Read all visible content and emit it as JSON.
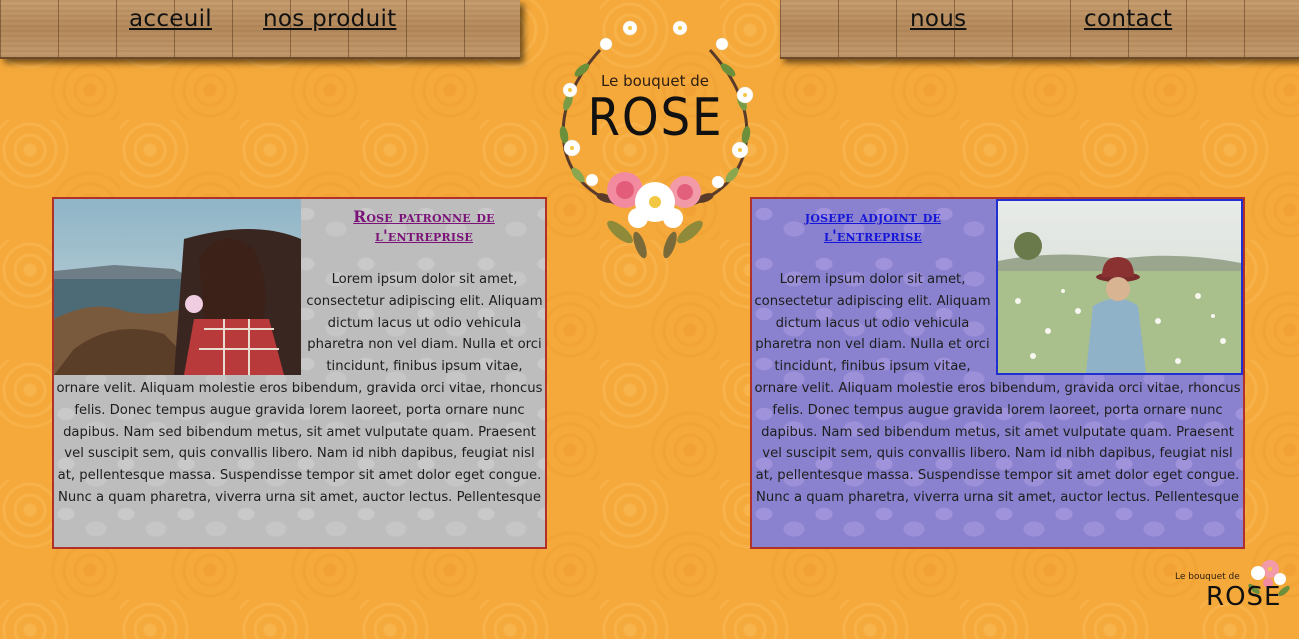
{
  "nav": {
    "left": [
      {
        "label": "acceuil"
      },
      {
        "label": "nos produit"
      }
    ],
    "right": [
      {
        "label": "nous"
      },
      {
        "label": "contact"
      }
    ]
  },
  "logo": {
    "line1": "Le bouquet de",
    "line2": "ROSE"
  },
  "cards": [
    {
      "title": "Rose patronne de l'entreprise",
      "body": "Lorem ipsum dolor sit amet, consectetur adipiscing elit. Aliquam dictum lacus ut odio vehicula pharetra non vel diam. Nulla et orci tincidunt, finibus ipsum vitae, ornare velit. Aliquam molestie eros bibendum, gravida orci vitae, rhoncus felis. Donec tempus augue gravida lorem laoreet, porta ornare nunc dapibus. Nam sed bibendum metus, sit amet vulputate quam. Praesent vel suscipit sem, quis convallis libero. Nam id nibh dapibus, feugiat nisl at, pellentesque massa. Suspendisse tempor sit amet dolor eget congue. Nunc a quam pharetra, viverra urna sit amet, auctor lectus. Pellentesque"
    },
    {
      "title": "josepe adjoint de l'entreprise",
      "body": "Lorem ipsum dolor sit amet, consectetur adipiscing elit. Aliquam dictum lacus ut odio vehicula pharetra non vel diam. Nulla et orci tincidunt, finibus ipsum vitae, ornare velit. Aliquam molestie eros bibendum, gravida orci vitae, rhoncus felis. Donec tempus augue gravida lorem laoreet, porta ornare nunc dapibus. Nam sed bibendum metus, sit amet vulputate quam. Praesent vel suscipit sem, quis convallis libero. Nam id nibh dapibus, feugiat nisl at, pellentesque massa. Suspendisse tempor sit amet dolor eget congue. Nunc a quam pharetra, viverra urna sit amet, auctor lectus. Pellentesque"
    }
  ],
  "footer_logo": {
    "line1": "Le bouquet de",
    "line2": "ROSE"
  },
  "colors": {
    "background": "#f5a93b",
    "card_left": "#bdbdbd",
    "card_right": "#8a82cf",
    "card_border": "#b0302a",
    "title_left": "#7a1277",
    "title_right": "#1515d8"
  }
}
